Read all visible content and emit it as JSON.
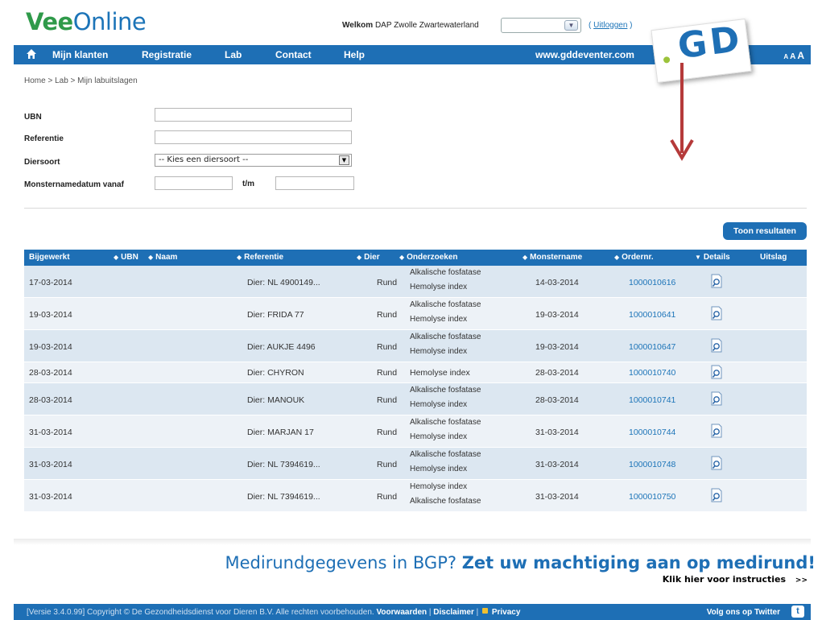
{
  "header": {
    "logo_vee": "Vee",
    "logo_online": "Online",
    "welcome_prefix": "Welkom",
    "welcome_user": "DAP Zwolle Zwartewaterland",
    "user_select_value": "",
    "logout_open": "(",
    "logout_label": "Uitloggen",
    "logout_close": ")",
    "gd_logo_text": "GD"
  },
  "nav": {
    "items": [
      "Mijn klanten",
      "Registratie",
      "Lab",
      "Contact",
      "Help"
    ],
    "site": "www.gddeventer.com",
    "font_sizes": [
      "A",
      "A",
      "A"
    ]
  },
  "breadcrumb": "Home > Lab > Mijn labuitslagen",
  "form": {
    "ubn_label": "UBN",
    "ubn_value": "",
    "referentie_label": "Referentie",
    "referentie_value": "",
    "diersoort_label": "Diersoort",
    "diersoort_value": "-- Kies een diersoort --",
    "datum_label": "Monsternamedatum vanaf",
    "datum_from": "",
    "tm_label": "t/m",
    "datum_to": ""
  },
  "show_results_label": "Toon resultaten",
  "table": {
    "headers": {
      "bijgewerkt": "Bijgewerkt",
      "ubn": "UBN",
      "naam": "Naam",
      "referentie": "Referentie",
      "dier": "Dier",
      "onderzoeken": "Onderzoeken",
      "monstername": "Monstername",
      "ordernr": "Ordernr.",
      "details": "Details",
      "uitslag": "Uitslag"
    },
    "rows": [
      {
        "date": "17-03-2014",
        "ref": "Dier: NL 4900149...",
        "dier": "Rund",
        "ond": [
          "Alkalische fosfatase",
          "Hemolyse index"
        ],
        "mdate": "14-03-2014",
        "order": "1000010616"
      },
      {
        "date": "19-03-2014",
        "ref": "Dier: FRIDA 77",
        "dier": "Rund",
        "ond": [
          "Alkalische fosfatase",
          "Hemolyse index"
        ],
        "mdate": "19-03-2014",
        "order": "1000010641"
      },
      {
        "date": "19-03-2014",
        "ref": "Dier: AUKJE 4496",
        "dier": "Rund",
        "ond": [
          "Alkalische fosfatase",
          "Hemolyse index"
        ],
        "mdate": "19-03-2014",
        "order": "1000010647"
      },
      {
        "date": "28-03-2014",
        "ref": "Dier: CHYRON",
        "dier": "Rund",
        "ond": [
          "Hemolyse index"
        ],
        "mdate": "28-03-2014",
        "order": "1000010740"
      },
      {
        "date": "28-03-2014",
        "ref": "Dier: MANOUK",
        "dier": "Rund",
        "ond": [
          "Alkalische fosfatase",
          "Hemolyse index"
        ],
        "mdate": "28-03-2014",
        "order": "1000010741"
      },
      {
        "date": "31-03-2014",
        "ref": "Dier: MARJAN 17",
        "dier": "Rund",
        "ond": [
          "Alkalische fosfatase",
          "Hemolyse index"
        ],
        "mdate": "31-03-2014",
        "order": "1000010744"
      },
      {
        "date": "31-03-2014",
        "ref": "Dier: NL 7394619...",
        "dier": "Rund",
        "ond": [
          "Alkalische fosfatase",
          "Hemolyse index"
        ],
        "mdate": "31-03-2014",
        "order": "1000010748"
      },
      {
        "date": "31-03-2014",
        "ref": "Dier: NL 7394619...",
        "dier": "Rund",
        "ond": [
          "Hemolyse index",
          "Alkalische fosfatase"
        ],
        "mdate": "31-03-2014",
        "order": "1000010750"
      }
    ]
  },
  "banner": {
    "normal": "Medirundgegevens in BGP?",
    "bold": "Zet uw machtiging aan op medirund!",
    "sub": "Klik hier voor instructies",
    "sub_arrows": ">>"
  },
  "footer": {
    "copyright": "[Versie 3.4.0.99] Copyright © De Gezondheidsdienst voor Dieren B.V. Alle rechten voorbehouden.",
    "voorwaarden": "Voorwaarden",
    "sep1": "|",
    "disclaimer": "Disclaimer",
    "sep2": "|",
    "privacy": "Privacy",
    "twitter": "Volg ons op Twitter",
    "twitter_icon_glyph": "t"
  },
  "colors": {
    "brand_blue": "#1e6fb5",
    "brand_green": "#2f9a4a",
    "row_odd": "#dce7f1",
    "row_even": "#edf2f7",
    "arrow_red": "#b53a3a"
  }
}
